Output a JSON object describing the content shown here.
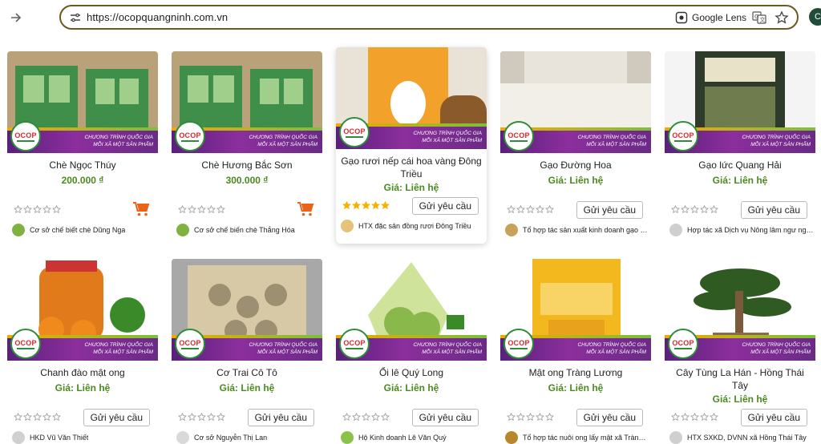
{
  "browser": {
    "url": "https://ocopquangninh.com.vn",
    "lens_label": "Google Lens",
    "profile_initial": "C",
    "icons": [
      "forward-icon",
      "tune-icon",
      "lens-icon",
      "translate-icon",
      "star-icon"
    ]
  },
  "colors": {
    "price_green": "#4a8a1f",
    "banner_purple": "#6b2a86",
    "cart_orange": "#e8641b",
    "omnibox_border": "#6b5a1e"
  },
  "banner": {
    "line1": "CHƯƠNG TRÌNH QUỐC GIA",
    "line2": "MỖI XÃ MỘT SẢN PHẨM",
    "badge": "OCOP"
  },
  "products": [
    {
      "title": "Chè Ngọc Thúy",
      "price": "200.000 ₫",
      "rating": 0,
      "action": "cart",
      "seller": "Cơ sở chế biết chè Dũng Nga",
      "thumb": "tea-box-green"
    },
    {
      "title": "Chè Hương Bắc Sơn",
      "price": "300.000 ₫",
      "rating": 0,
      "action": "cart",
      "seller": "Cơ sở chế biến chè Thắng Hóa",
      "thumb": "tea-box-green"
    },
    {
      "title": "Gạo rươi nếp cái hoa vàng Đông Triều",
      "price": "Giá: Liên hệ",
      "rating": 5,
      "action": "request",
      "seller": "HTX đặc sản đồng rươi Đông Triều",
      "thumb": "rice-bag-orange"
    },
    {
      "title": "Gạo Đường Hoa",
      "price": "Giá: Liên hệ",
      "rating": 0,
      "action": "request",
      "seller": "Tổ hợp tác sản xuất kinh doanh gạo Đường Hoa",
      "thumb": "rice-white"
    },
    {
      "title": "Gạo lức Quang Hải",
      "price": "Giá: Liên hệ",
      "rating": 0,
      "action": "request",
      "seller": "Hợp tác xã Dịch vụ Nông lâm ngư nghiệp Quang Hải",
      "thumb": "rice-bag-dark"
    },
    {
      "title": "Chanh đào mật ong",
      "price": "Giá: Liên hệ",
      "rating": 0,
      "action": "request",
      "seller": "HKD Vũ Văn Thiết",
      "thumb": "lemon-jar"
    },
    {
      "title": "Cơ Trai Cô Tô",
      "price": "Giá: Liên hệ",
      "rating": 0,
      "action": "request",
      "seller": "Cơ sở Nguyễn Thị Lan",
      "thumb": "scallop-pack"
    },
    {
      "title": "Ổi lê Quý Long",
      "price": "Giá: Liên hệ",
      "rating": 0,
      "action": "request",
      "seller": "Hộ Kinh doanh Lê Văn Quý",
      "thumb": "guava-net"
    },
    {
      "title": "Mật ong Tràng Lương",
      "price": "Giá: Liên hệ",
      "rating": 0,
      "action": "request",
      "seller": "Tổ hợp tác nuôi ong lấy mật xã Tràng Lương",
      "thumb": "honey-box"
    },
    {
      "title": "Cây Tùng La Hán - Hồng Thái Tây",
      "price": "Giá: Liên hệ",
      "rating": 0,
      "action": "request",
      "seller": "HTX SXKD, DVNN xã Hồng Thái Tây",
      "thumb": "bonsai"
    }
  ],
  "request_label": "Gửi yêu cầu"
}
